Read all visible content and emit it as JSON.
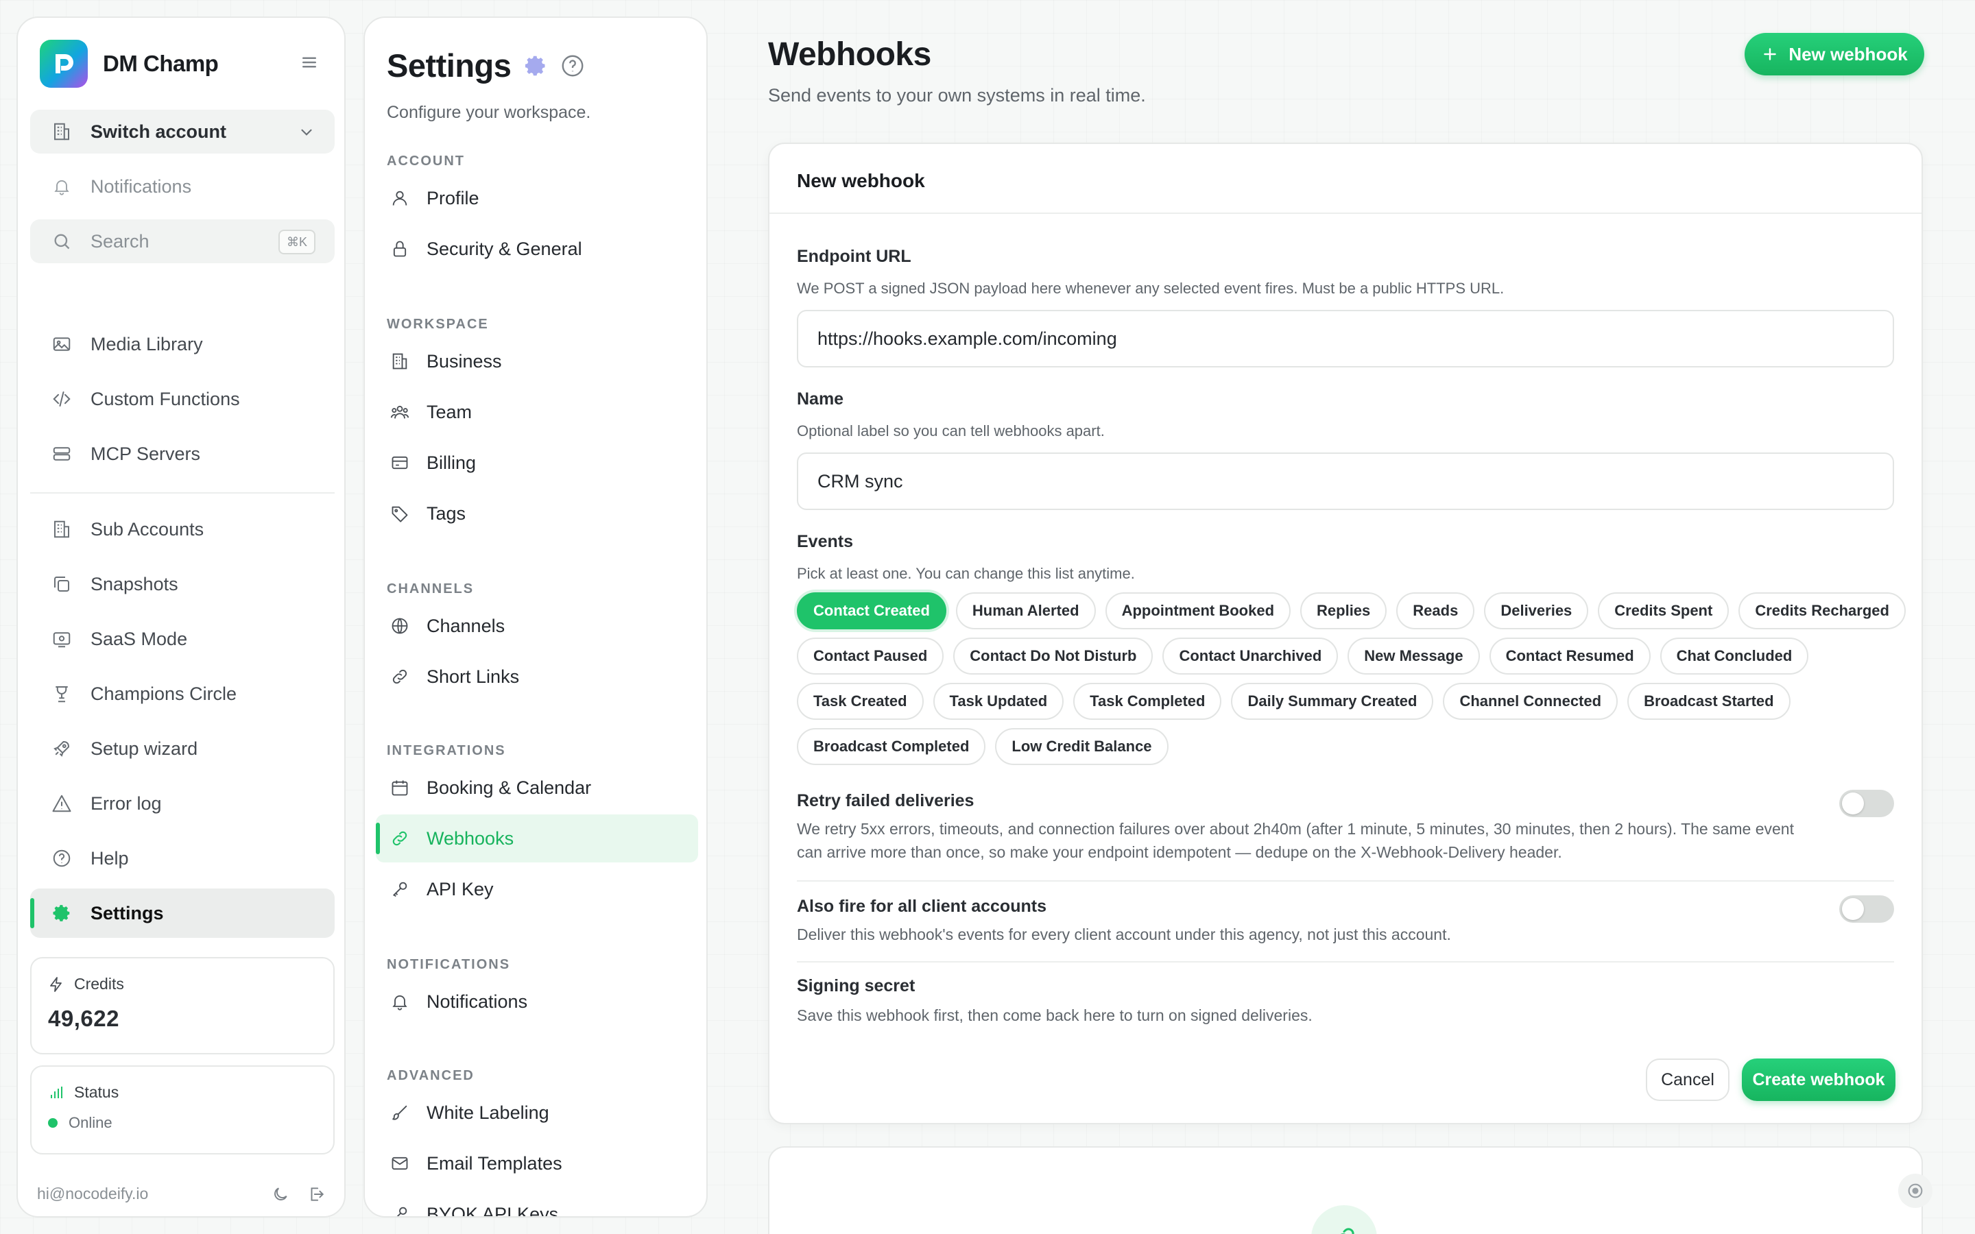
{
  "sidebar": {
    "brand": "DM Champ",
    "switch_account": "Switch account",
    "notifications": "Notifications",
    "search_placeholder": "Search",
    "search_shortcut": "⌘K",
    "items": [
      {
        "label": "Media Library",
        "icon": "image-icon"
      },
      {
        "label": "Custom Functions",
        "icon": "code-icon"
      },
      {
        "label": "MCP Servers",
        "icon": "server-icon"
      },
      {
        "label": "Sub Accounts",
        "icon": "building-icon"
      },
      {
        "label": "Snapshots",
        "icon": "copy-icon"
      },
      {
        "label": "SaaS Mode",
        "icon": "screen-icon"
      },
      {
        "label": "Champions Circle",
        "icon": "trophy-icon"
      },
      {
        "label": "Setup wizard",
        "icon": "rocket-icon"
      },
      {
        "label": "Error log",
        "icon": "warning-icon"
      },
      {
        "label": "Help",
        "icon": "help-icon"
      },
      {
        "label": "Settings",
        "icon": "gear-icon"
      }
    ],
    "credits_label": "Credits",
    "credits_value": "49,622",
    "status_label": "Status",
    "status_value": "Online",
    "email": "hi@nocodeify.io"
  },
  "settings": {
    "title": "Settings",
    "subtitle": "Configure your workspace.",
    "sections": {
      "account": "ACCOUNT",
      "workspace": "WORKSPACE",
      "channels": "CHANNELS",
      "integrations": "INTEGRATIONS",
      "notifications": "NOTIFICATIONS",
      "advanced": "ADVANCED"
    },
    "items": {
      "profile": "Profile",
      "security": "Security & General",
      "business": "Business",
      "team": "Team",
      "billing": "Billing",
      "tags": "Tags",
      "channels": "Channels",
      "short_links": "Short Links",
      "booking": "Booking & Calendar",
      "webhooks": "Webhooks",
      "api_key": "API Key",
      "notifications": "Notifications",
      "white_labeling": "White Labeling",
      "email_templates": "Email Templates",
      "byok": "BYOK API Keys"
    }
  },
  "main": {
    "title": "Webhooks",
    "subtitle": "Send events to your own systems in real time.",
    "new_button": "New webhook",
    "card_title": "New webhook",
    "endpoint_label": "Endpoint URL",
    "endpoint_help": "We POST a signed JSON payload here whenever any selected event fires. Must be a public HTTPS URL.",
    "endpoint_value": "https://hooks.example.com/incoming",
    "name_label": "Name",
    "name_help": "Optional label so you can tell webhooks apart.",
    "name_value": "CRM sync",
    "events_label": "Events",
    "events_help": "Pick at least one. You can change this list anytime.",
    "events": [
      [
        "Contact Created",
        "Human Alerted",
        "Appointment Booked",
        "Replies",
        "Reads",
        "Deliveries",
        "Credits Spent",
        "Credits Recharged"
      ],
      [
        "Contact Paused",
        "Contact Do Not Disturb",
        "Contact Unarchived",
        "New Message",
        "Contact Resumed",
        "Chat Concluded"
      ],
      [
        "Task Created",
        "Task Updated",
        "Task Completed",
        "Daily Summary Created",
        "Channel Connected",
        "Broadcast Started"
      ],
      [
        "Broadcast Completed",
        "Low Credit Balance"
      ]
    ],
    "selected_event": "Contact Created",
    "retry_label": "Retry failed deliveries",
    "retry_desc": "We retry 5xx errors, timeouts, and connection failures over about 2h40m (after 1 minute, 5 minutes, 30 minutes, then 2 hours). The same event can arrive more than once, so make your endpoint idempotent — dedupe on the X-Webhook-Delivery header.",
    "retry_enabled": false,
    "client_label": "Also fire for all client accounts",
    "client_desc": "Deliver this webhook's events for every client account under this agency, not just this account.",
    "client_enabled": false,
    "secret_label": "Signing secret",
    "secret_desc": "Save this webhook first, then come back here to turn on signed deliveries.",
    "cancel": "Cancel",
    "create": "Create webhook"
  },
  "colors": {
    "accent": "#1fc36a",
    "accent_light": "#e8f8ee"
  }
}
